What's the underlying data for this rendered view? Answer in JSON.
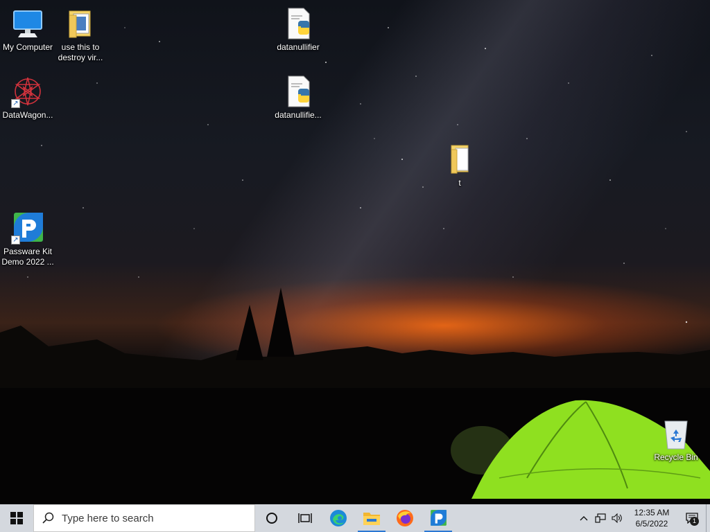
{
  "desktop": {
    "icons": [
      {
        "label": "My Computer",
        "type": "computer"
      },
      {
        "label": "use this to destroy vir...",
        "type": "folder-docs"
      },
      {
        "label": "datanullifier",
        "type": "python-file"
      },
      {
        "label": "DataWagon...",
        "type": "shortcut-app"
      },
      {
        "label": "datanullifie...",
        "type": "python-file"
      },
      {
        "label": "t",
        "type": "folder"
      },
      {
        "label": "Passware Kit Demo 2022 ...",
        "type": "shortcut-app"
      },
      {
        "label": "Recycle Bin",
        "type": "recycle-bin"
      }
    ]
  },
  "taskbar": {
    "search_placeholder": "Type here to search",
    "pinned": [
      "edge-icon",
      "file-explorer-icon",
      "firefox-icon",
      "passware-icon"
    ],
    "clock_time": "12:35 AM",
    "clock_date": "6/5/2022",
    "notification_count": "1"
  },
  "colors": {
    "taskbar_bg": "#d4d8de",
    "active_indicator": "#2b78d4",
    "tent_green": "#8fe020",
    "horizon_orange": "#ff6e14"
  }
}
